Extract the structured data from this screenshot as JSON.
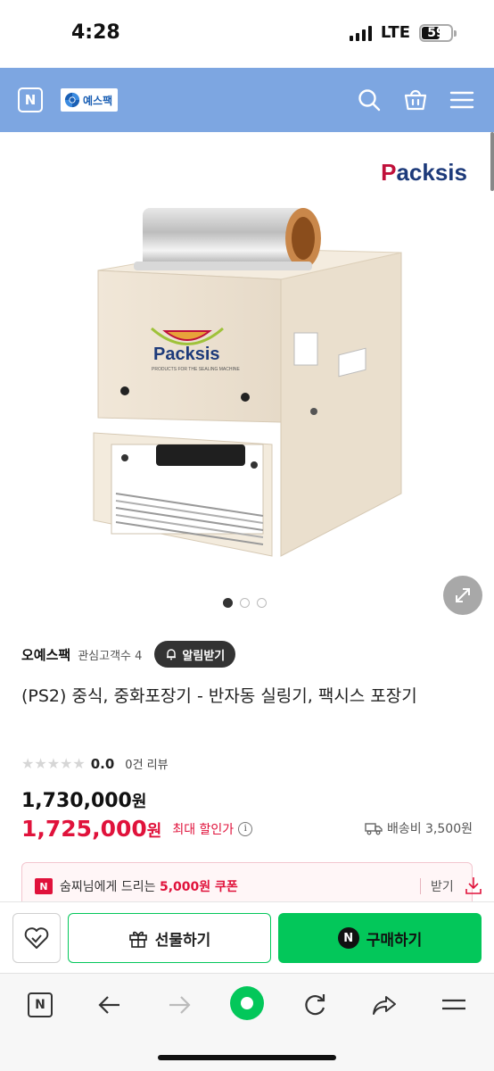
{
  "status_bar": {
    "time": "4:28",
    "network": "LTE",
    "battery": "59"
  },
  "header": {
    "n_label": "N",
    "brand_name": "예스팩",
    "background_color": "#7da6e1"
  },
  "product_image": {
    "logo_prefix": "P",
    "logo_rest": "acksis",
    "machine_label": "Packsis",
    "machine_caption": "PRODUCTS FOR THE SEALING MACHINE",
    "carousel_total": 3,
    "carousel_active": 1
  },
  "store": {
    "name": "오예스팩",
    "fans": "관심고객수 4",
    "alarm_label": "알림받기"
  },
  "product": {
    "title": "(PS2) 중식, 중화포장기 - 반자동 실링기, 팩시스 포장기",
    "rating": "0.0",
    "review_count": "0건 리뷰",
    "original_price": "1,730,000",
    "sale_price": "1,725,000",
    "currency": "원",
    "sale_label": "최대 할인가",
    "info_icon": "i",
    "shipping": "배송비 3,500원",
    "accent_color": "#e0123b"
  },
  "coupon": {
    "badge": "N",
    "text_prefix": "숨찌님에게 드리는 ",
    "amount": "5,000원 쿠폰",
    "get_label": "받기"
  },
  "buy_bar": {
    "gift_label": "선물하기",
    "buy_label": "구매하기",
    "buy_badge": "N",
    "buy_color": "#03c75a"
  },
  "browser_bar": {
    "n_label": "N",
    "icons": [
      "n-home-icon",
      "back-arrow-icon",
      "forward-arrow-icon",
      "green-dot-icon",
      "reload-icon",
      "share-icon",
      "menu-icon"
    ]
  }
}
